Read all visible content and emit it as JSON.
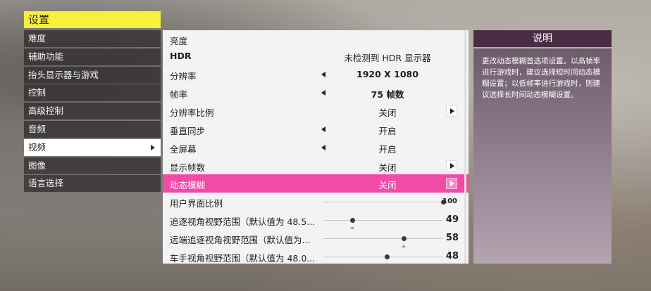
{
  "settings": {
    "title": "设置",
    "menu": [
      {
        "label": "难度",
        "active": false
      },
      {
        "label": "辅助功能",
        "active": false
      },
      {
        "label": "抬头显示器与游戏",
        "active": false
      },
      {
        "label": "控制",
        "active": false
      },
      {
        "label": "高级控制",
        "active": false
      },
      {
        "label": "音频",
        "active": false
      },
      {
        "label": "视频",
        "active": true
      },
      {
        "label": "图像",
        "active": false
      },
      {
        "label": "语言选择",
        "active": false
      }
    ]
  },
  "video": {
    "rows": [
      {
        "label": "亮度",
        "value": "",
        "controls": "none"
      },
      {
        "label": "HDR",
        "value": "未检测到 HDR 显示器",
        "controls": "none"
      },
      {
        "label": "分辨率",
        "value": "1920 X 1080",
        "controls": "left"
      },
      {
        "label": "帧率",
        "value": "75 帧数",
        "controls": "left"
      },
      {
        "label": "分辨率比例",
        "value": "关闭",
        "controls": "right"
      },
      {
        "label": "垂直同步",
        "value": "开启",
        "controls": "left"
      },
      {
        "label": "全屏幕",
        "value": "开启",
        "controls": "left"
      },
      {
        "label": "显示帧数",
        "value": "关闭",
        "controls": "right"
      },
      {
        "label": "动态模糊",
        "value": "关闭",
        "controls": "right",
        "selected": true
      }
    ],
    "sliders": [
      {
        "label": "用户界面比例",
        "value": "100",
        "level": 1.0,
        "default_level": null
      },
      {
        "label": "追逐视角视野范围（默认值为 48.5...",
        "value": "49",
        "level": 0.24,
        "default_level": 0.24
      },
      {
        "label": "远端追逐视角视野范围（默认值为...",
        "value": "58",
        "level": 0.67,
        "default_level": 0.67
      },
      {
        "label": "车手视角视野范围（默认值为 48.0...",
        "value": "48",
        "level": 0.53,
        "default_level": 0.53
      }
    ]
  },
  "description": {
    "title": "说明",
    "text": "更改动态模糊首选项设置。以高帧率进行游戏时，建议选择短时间动态模糊设置；以低帧率进行游戏时，则建议选择长时间动态模糊设置。"
  },
  "colors": {
    "accent_yellow": "#f7f03d",
    "selected_pink": "#f24aa6",
    "desc_header": "#4a2d45"
  },
  "icons": {
    "left_arrow": "triangle-left-icon",
    "right_arrow": "triangle-right-icon",
    "menu_arrow": "triangle-right-icon"
  }
}
